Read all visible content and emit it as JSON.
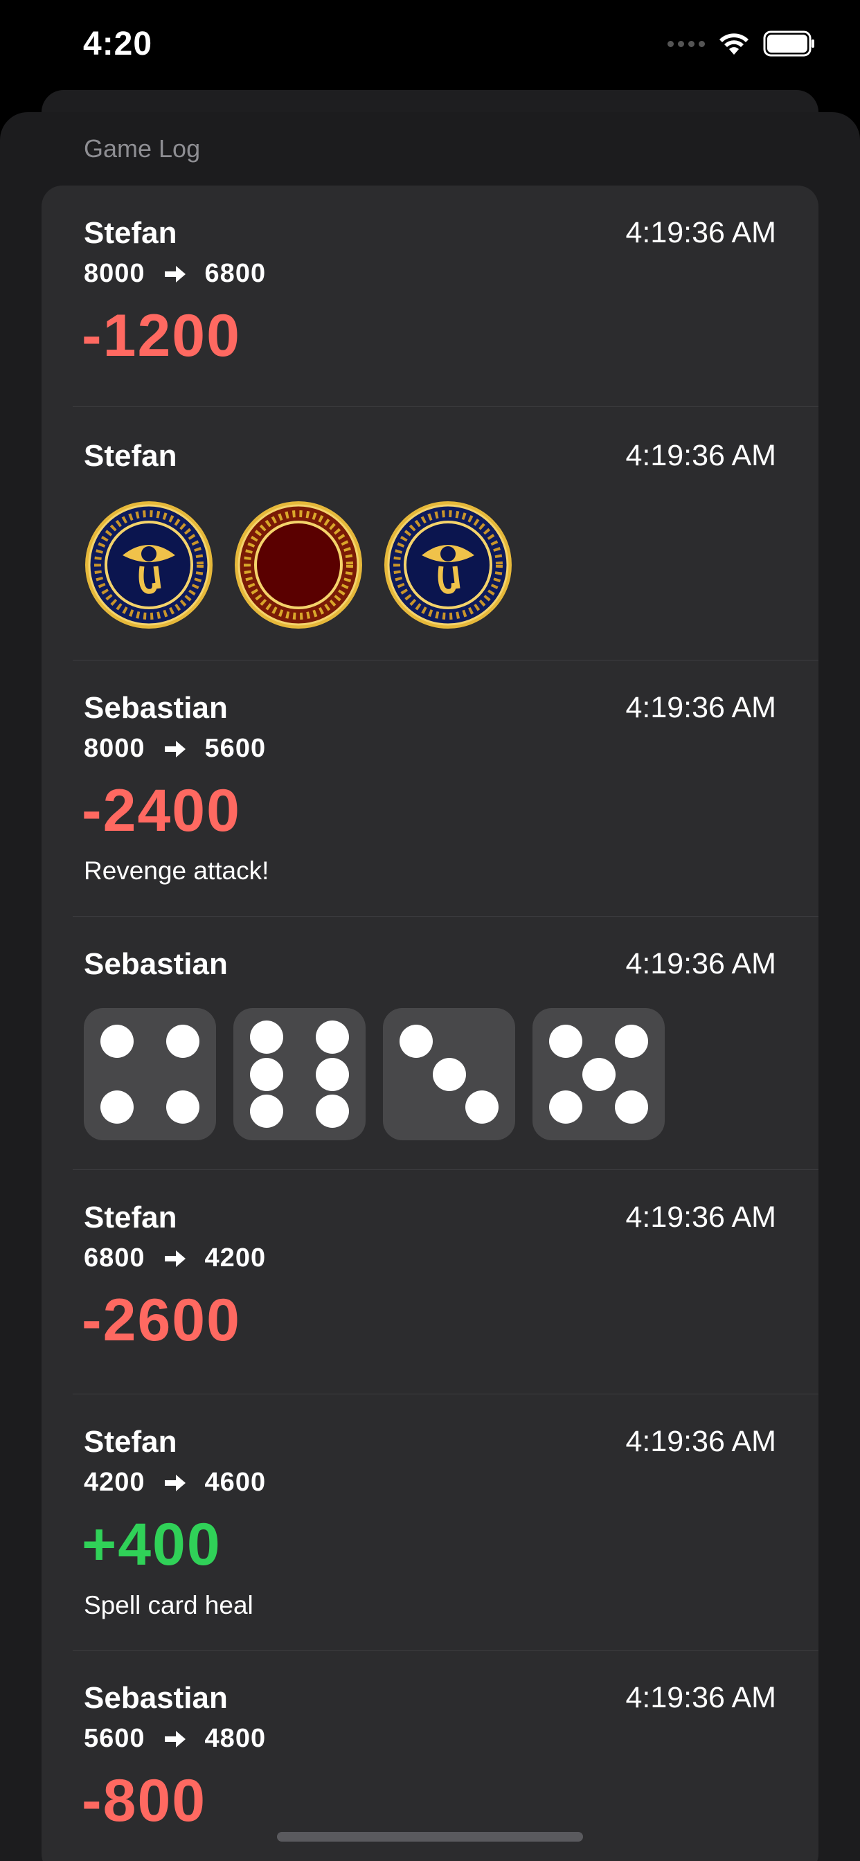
{
  "status_bar": {
    "time": "4:20"
  },
  "title": "Game Log",
  "entries": [
    {
      "kind": "life",
      "name": "Stefan",
      "time": "4:19:36 AM",
      "from": "8000",
      "to": "6800",
      "delta": "-1200",
      "sign": "neg",
      "note": ""
    },
    {
      "kind": "coins",
      "name": "Stefan",
      "time": "4:19:36 AM",
      "coins": [
        "heads",
        "tails",
        "heads"
      ]
    },
    {
      "kind": "life",
      "name": "Sebastian",
      "time": "4:19:36 AM",
      "from": "8000",
      "to": "5600",
      "delta": "-2400",
      "sign": "neg",
      "note": "Revenge attack!"
    },
    {
      "kind": "dice",
      "name": "Sebastian",
      "time": "4:19:36 AM",
      "dice": [
        4,
        6,
        3,
        5
      ]
    },
    {
      "kind": "life",
      "name": "Stefan",
      "time": "4:19:36 AM",
      "from": "6800",
      "to": "4200",
      "delta": "-2600",
      "sign": "neg",
      "note": ""
    },
    {
      "kind": "life",
      "name": "Stefan",
      "time": "4:19:36 AM",
      "from": "4200",
      "to": "4600",
      "delta": "+400",
      "sign": "pos",
      "note": "Spell card heal"
    },
    {
      "kind": "life",
      "name": "Sebastian",
      "time": "4:19:36 AM",
      "from": "5600",
      "to": "4800",
      "delta": "-800",
      "sign": "neg",
      "note": ""
    }
  ],
  "colors": {
    "negative": "#ff6961",
    "positive": "#30d158",
    "coin_heads_face": "#0d1a5c",
    "coin_tails_face": "#5a0000",
    "coin_gold": "#d9a72a"
  },
  "icons": {
    "arrow": "right-arrow-icon",
    "coin_heads": "eye-of-horus-coin-icon",
    "coin_tails": "blank-red-coin-icon",
    "wifi": "wifi-icon",
    "battery": "battery-icon",
    "signal": "cellular-signal-icon"
  }
}
